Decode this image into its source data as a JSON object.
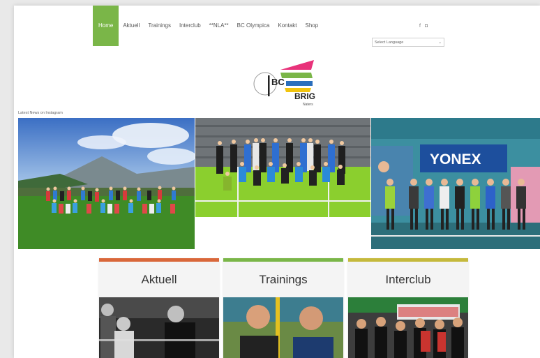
{
  "nav": {
    "items": [
      {
        "label": "Home",
        "active": true
      },
      {
        "label": "Aktuell"
      },
      {
        "label": "Trainings"
      },
      {
        "label": "Interclub"
      },
      {
        "label": "**NLA**"
      },
      {
        "label": "BC Olympica"
      },
      {
        "label": "Kontakt"
      },
      {
        "label": "Shop"
      }
    ]
  },
  "social": {
    "icons": [
      "facebook-icon",
      "instagram-icon"
    ],
    "facebook_glyph": "f",
    "instagram_glyph": "◘"
  },
  "language": {
    "value": "Select Language"
  },
  "logo": {
    "line1": "BC",
    "line2": "BRIG",
    "line3": "Naters"
  },
  "instagram": {
    "label": "Latest News on Instagram"
  },
  "banner_text": "YONEX",
  "cards": [
    {
      "title": "Aktuell"
    },
    {
      "title": "Trainings"
    },
    {
      "title": "Interclub"
    }
  ],
  "colors": {
    "accent_green": "#7ab648",
    "card_orange": "#d9673a",
    "card_olive": "#c5b93c",
    "logo_pink": "#e8327a"
  }
}
